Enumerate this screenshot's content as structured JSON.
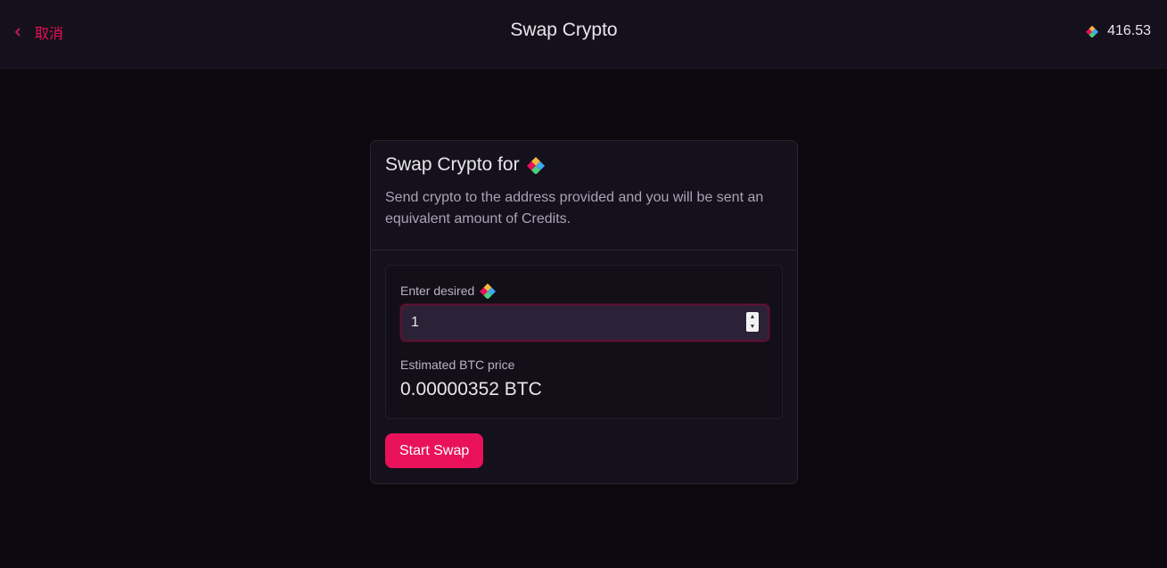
{
  "header": {
    "back_label": "取消",
    "title": "Swap Crypto",
    "balance": "416.53",
    "balance_icon": "credits-logo-icon"
  },
  "card": {
    "title": "Swap Crypto for",
    "title_icon": "credits-logo-icon",
    "description": "Send crypto to the address provided and you will be sent an equivalent amount of Credits.",
    "amount_label": "Enter desired",
    "amount_value": "1",
    "estimate_label": "Estimated BTC price",
    "estimate_value": "0.00000352 BTC",
    "submit_label": "Start Swap"
  },
  "colors": {
    "accent": "#e8115a",
    "background": "#0c0a10",
    "surface": "#15111c"
  }
}
